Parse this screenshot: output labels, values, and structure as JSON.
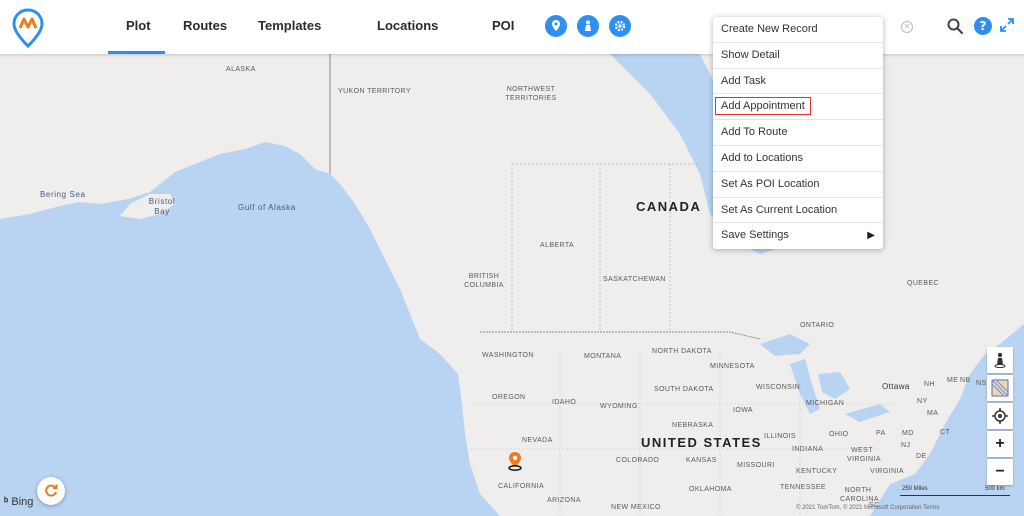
{
  "nav": {
    "tabs": [
      {
        "label": "Plot",
        "active": true
      },
      {
        "label": "Routes",
        "active": false
      },
      {
        "label": "Templates",
        "active": false
      },
      {
        "label": "Locations",
        "active": false
      },
      {
        "label": "POI",
        "active": false
      }
    ],
    "toolbar_icons": [
      "map-pin-icon",
      "person-pin-icon",
      "settings-icon"
    ],
    "right_icons": [
      "clear-icon",
      "search-icon",
      "help-icon",
      "expand-icon"
    ],
    "help_glyph": "?"
  },
  "context_menu": {
    "items": [
      {
        "label": "Create New Record"
      },
      {
        "label": "Show Detail"
      },
      {
        "label": "Add Task"
      },
      {
        "label": "Add Appointment",
        "highlighted": true
      },
      {
        "label": "Add To Route"
      },
      {
        "label": "Add to Locations"
      },
      {
        "label": "Set As POI Location"
      },
      {
        "label": "Set As Current Location"
      },
      {
        "label": "Save Settings",
        "has_submenu": true
      }
    ],
    "submenu_glyph": "▶"
  },
  "map": {
    "labels": {
      "alaska": "ALASKA",
      "yukon": "YUKON TERRITORY",
      "nwt": "NORTHWEST TERRITORIES",
      "canada": "CANADA",
      "bering": "Bering Sea",
      "bristol": "Bristol Bay",
      "gulf": "Gulf of Alaska",
      "alberta": "ALBERTA",
      "bc": "BRITISH COLUMBIA",
      "sask": "SASKATCHEWAN",
      "quebec": "QUEBEC",
      "ontario": "ONTARIO",
      "washington": "WASHINGTON",
      "montana": "MONTANA",
      "nd": "NORTH DAKOTA",
      "minnesota": "MINNESOTA",
      "sd": "SOUTH DAKOTA",
      "wisconsin": "WISCONSIN",
      "oregon": "OREGON",
      "idaho": "IDAHO",
      "wyoming": "WYOMING",
      "michigan": "MICHIGAN",
      "nebraska": "NEBRASKA",
      "iowa": "IOWA",
      "nevada": "NEVADA",
      "usa": "UNITED STATES",
      "illinois": "ILLINOIS",
      "ohio": "OHIO",
      "pa": "PA",
      "ny": "NY",
      "ma": "MA",
      "ottawa": "Ottawa",
      "nh": "NH",
      "me": "ME",
      "nb": "NB",
      "ns": "NS",
      "colorado": "COLORADO",
      "kansas": "KANSAS",
      "missouri": "MISSOURI",
      "indiana": "INDIANA",
      "wv": "WEST VIRGINIA",
      "virginia": "VIRGINIA",
      "nj": "NJ",
      "md": "MD",
      "de": "DE",
      "ct": "CT",
      "kentucky": "KENTUCKY",
      "california": "CALIFORNIA",
      "arizona": "ARIZONA",
      "newmexico": "NEW MEXICO",
      "oklahoma": "OKLAHOMA",
      "tennessee": "TENNESSEE",
      "nc": "NORTH CAROLINA",
      "sc": "SC"
    },
    "scale_small": "250 Miles",
    "scale_large": "500 km",
    "copyright": "© 2021 TomTom, © 2021 Microsoft Corporation  Terms",
    "bing": "Bing"
  },
  "controls": {
    "zoom_in": "+",
    "zoom_out": "−"
  },
  "colors": {
    "accent": "#2f8ff0",
    "water": "#b9d3f2",
    "land": "#efeeec",
    "highlight_border": "#e0322a",
    "pin": "#f07a1e"
  }
}
